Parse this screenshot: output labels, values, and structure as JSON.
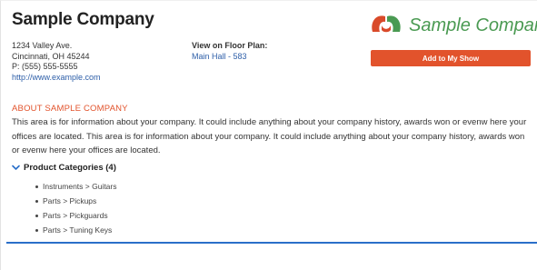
{
  "company": {
    "name": "Sample Company",
    "address_line1": "1234 Valley Ave.",
    "address_line2": "Cincinnati, OH 45244",
    "phone": "P: (555) 555-5555",
    "website": "http://www.example.com"
  },
  "floor_plan": {
    "label": "View on Floor Plan:",
    "location": "Main Hall - 583"
  },
  "logo": {
    "text": "Sample Company",
    "colors": {
      "red": "#d94a2a",
      "green": "#4a9a52"
    }
  },
  "actions": {
    "add_to_show": "Add to My Show",
    "accent": "#e2532c"
  },
  "about": {
    "heading": "ABOUT SAMPLE COMPANY",
    "text": "This area is for information about your company. It could include anything about your company history, awards won or evenw here your offices are located. This area is for information about your company. It could include anything about your company history, awards won or evenw here your offices are located."
  },
  "categories": {
    "title": "Product Categories (4)",
    "toggle_icon": "chevron-down-icon",
    "items": [
      "Instruments > Guitars",
      "Parts > Pickups",
      "Parts > Pickguards",
      "Parts > Tuning Keys"
    ]
  },
  "divider_color": "#2a6fc9"
}
